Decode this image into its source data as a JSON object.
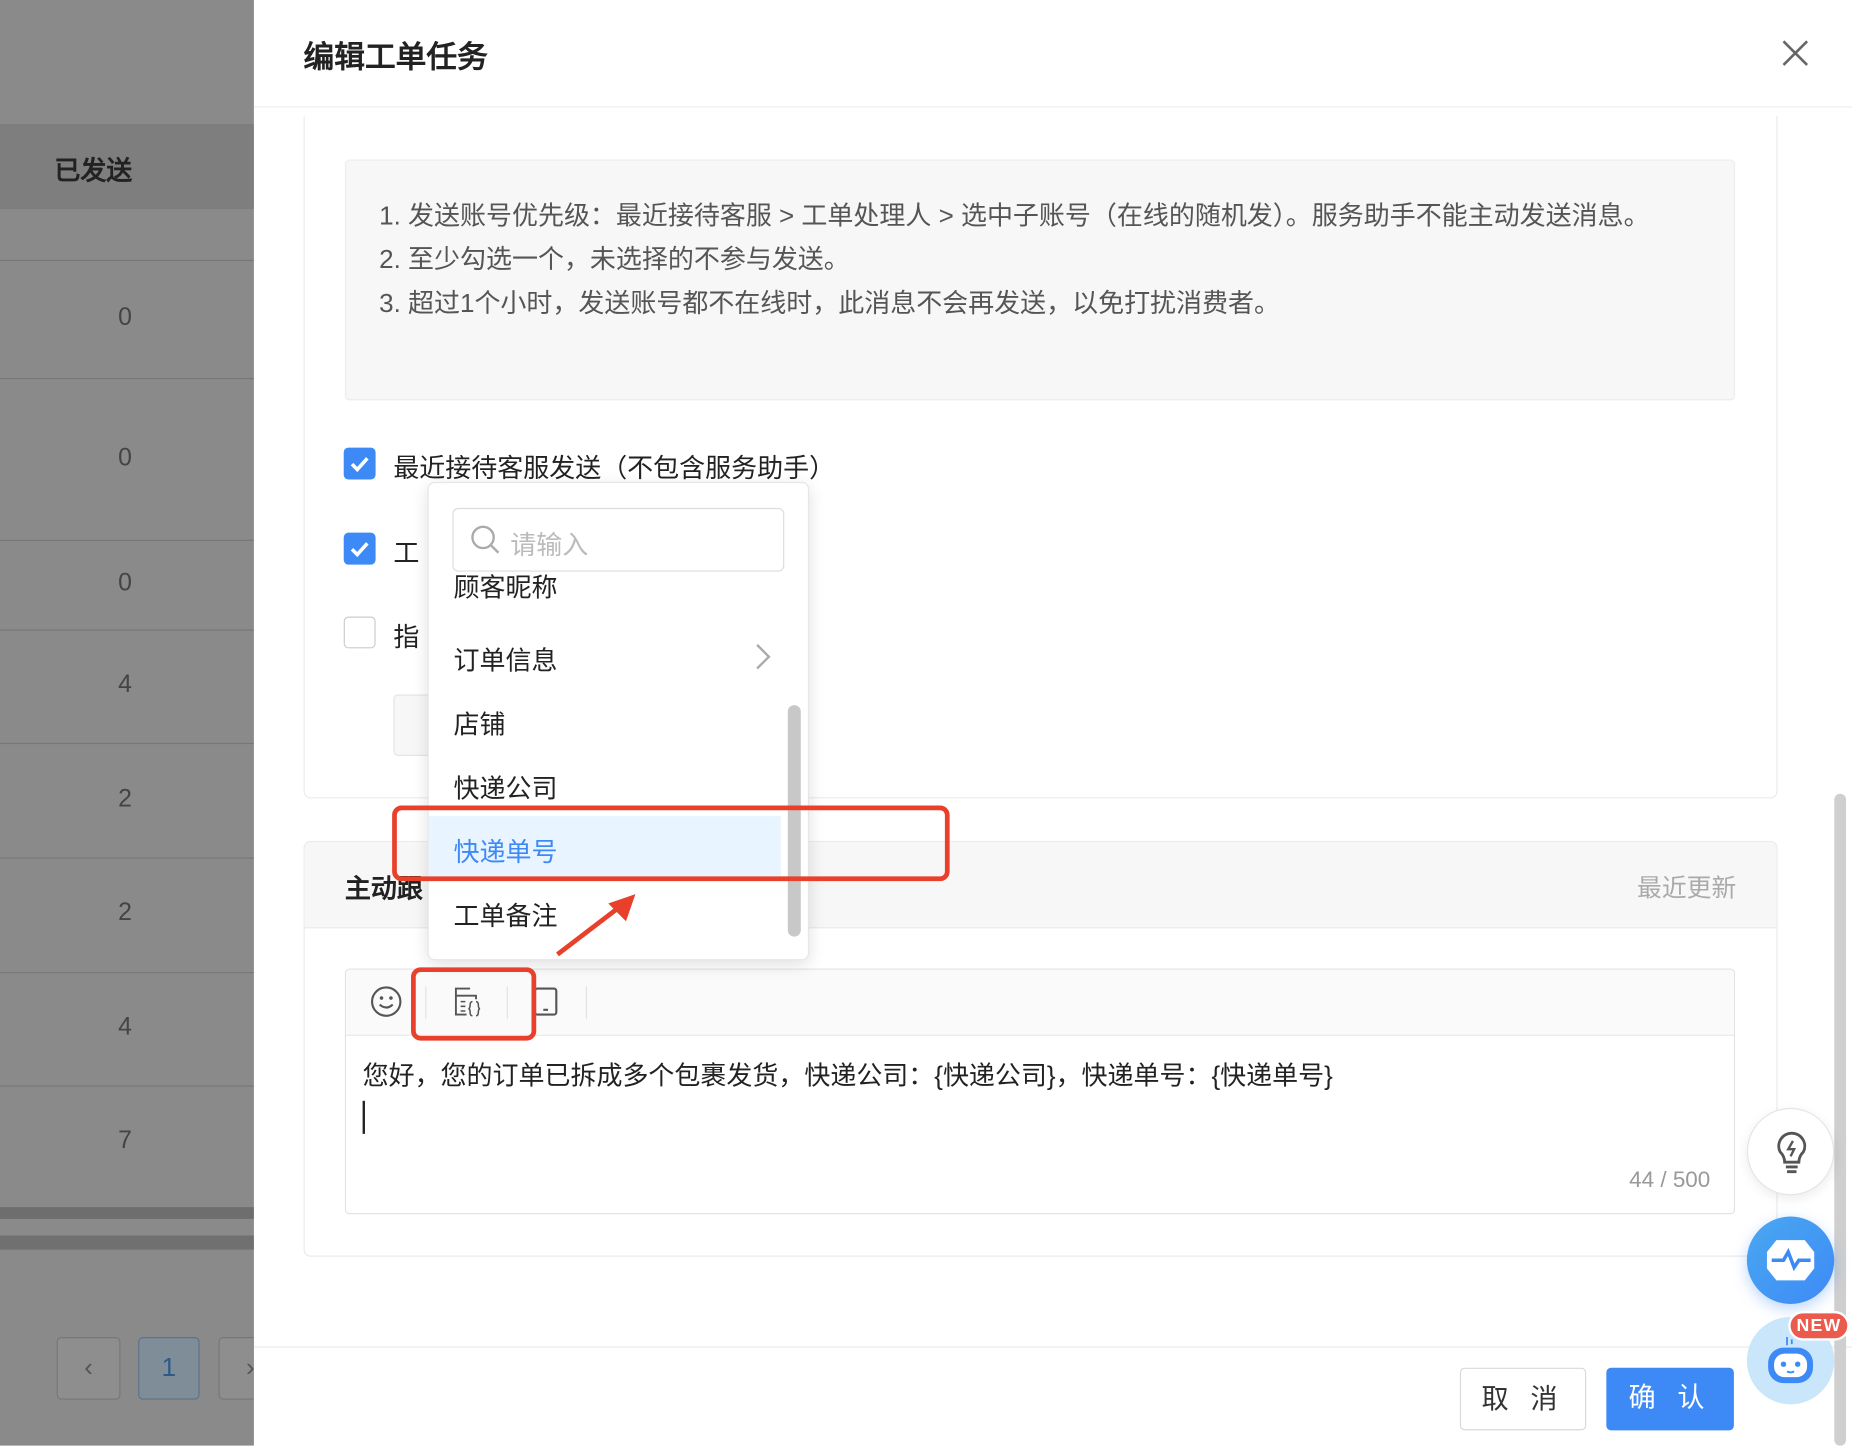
{
  "background_table": {
    "column_header": "已发送",
    "values": [
      "0",
      "0",
      "0",
      "4",
      "2",
      "2",
      "4",
      "7"
    ],
    "pagination": {
      "current_page": "1"
    }
  },
  "drawer": {
    "title": "编辑工单任务",
    "info_lines": [
      "1. 发送账号优先级：最近接待客服 > 工单处理人 > 选中子账号（在线的随机发）。服务助手不能主动发送消息。",
      "2. 至少勾选一个，未选择的不参与发送。",
      "3. 超过1个小时，发送账号都不在线时，此消息不会再发送，以免打扰消费者。"
    ],
    "options": [
      {
        "label": "最近接待客服发送（不包含服务助手）",
        "checked": true
      },
      {
        "label": "工",
        "checked": true
      },
      {
        "label": "指",
        "checked": false
      }
    ],
    "section2": {
      "title": "主动跟",
      "right_label": "最近更新"
    },
    "editor": {
      "content": "您好，您的订单已拆成多个包裹发货，快递公司：{快递公司}，快递单号：{快递单号}",
      "counter": "44 / 500",
      "toolbar_icons": [
        "emoji-icon",
        "variable-icon",
        "phone-icon"
      ]
    },
    "footer": {
      "cancel": "取 消",
      "confirm": "确 认"
    }
  },
  "dropdown": {
    "search_placeholder": "请输入",
    "items": [
      "顾客昵称",
      "订单信息",
      "店铺",
      "快递公司",
      "快递单号",
      "工单备注"
    ],
    "selected": "快递单号"
  },
  "floating": {
    "badge": "NEW"
  },
  "colors": {
    "primary": "#3d8af7",
    "annotation": "#e8402a",
    "highlight_bg": "#e8f4ff"
  }
}
